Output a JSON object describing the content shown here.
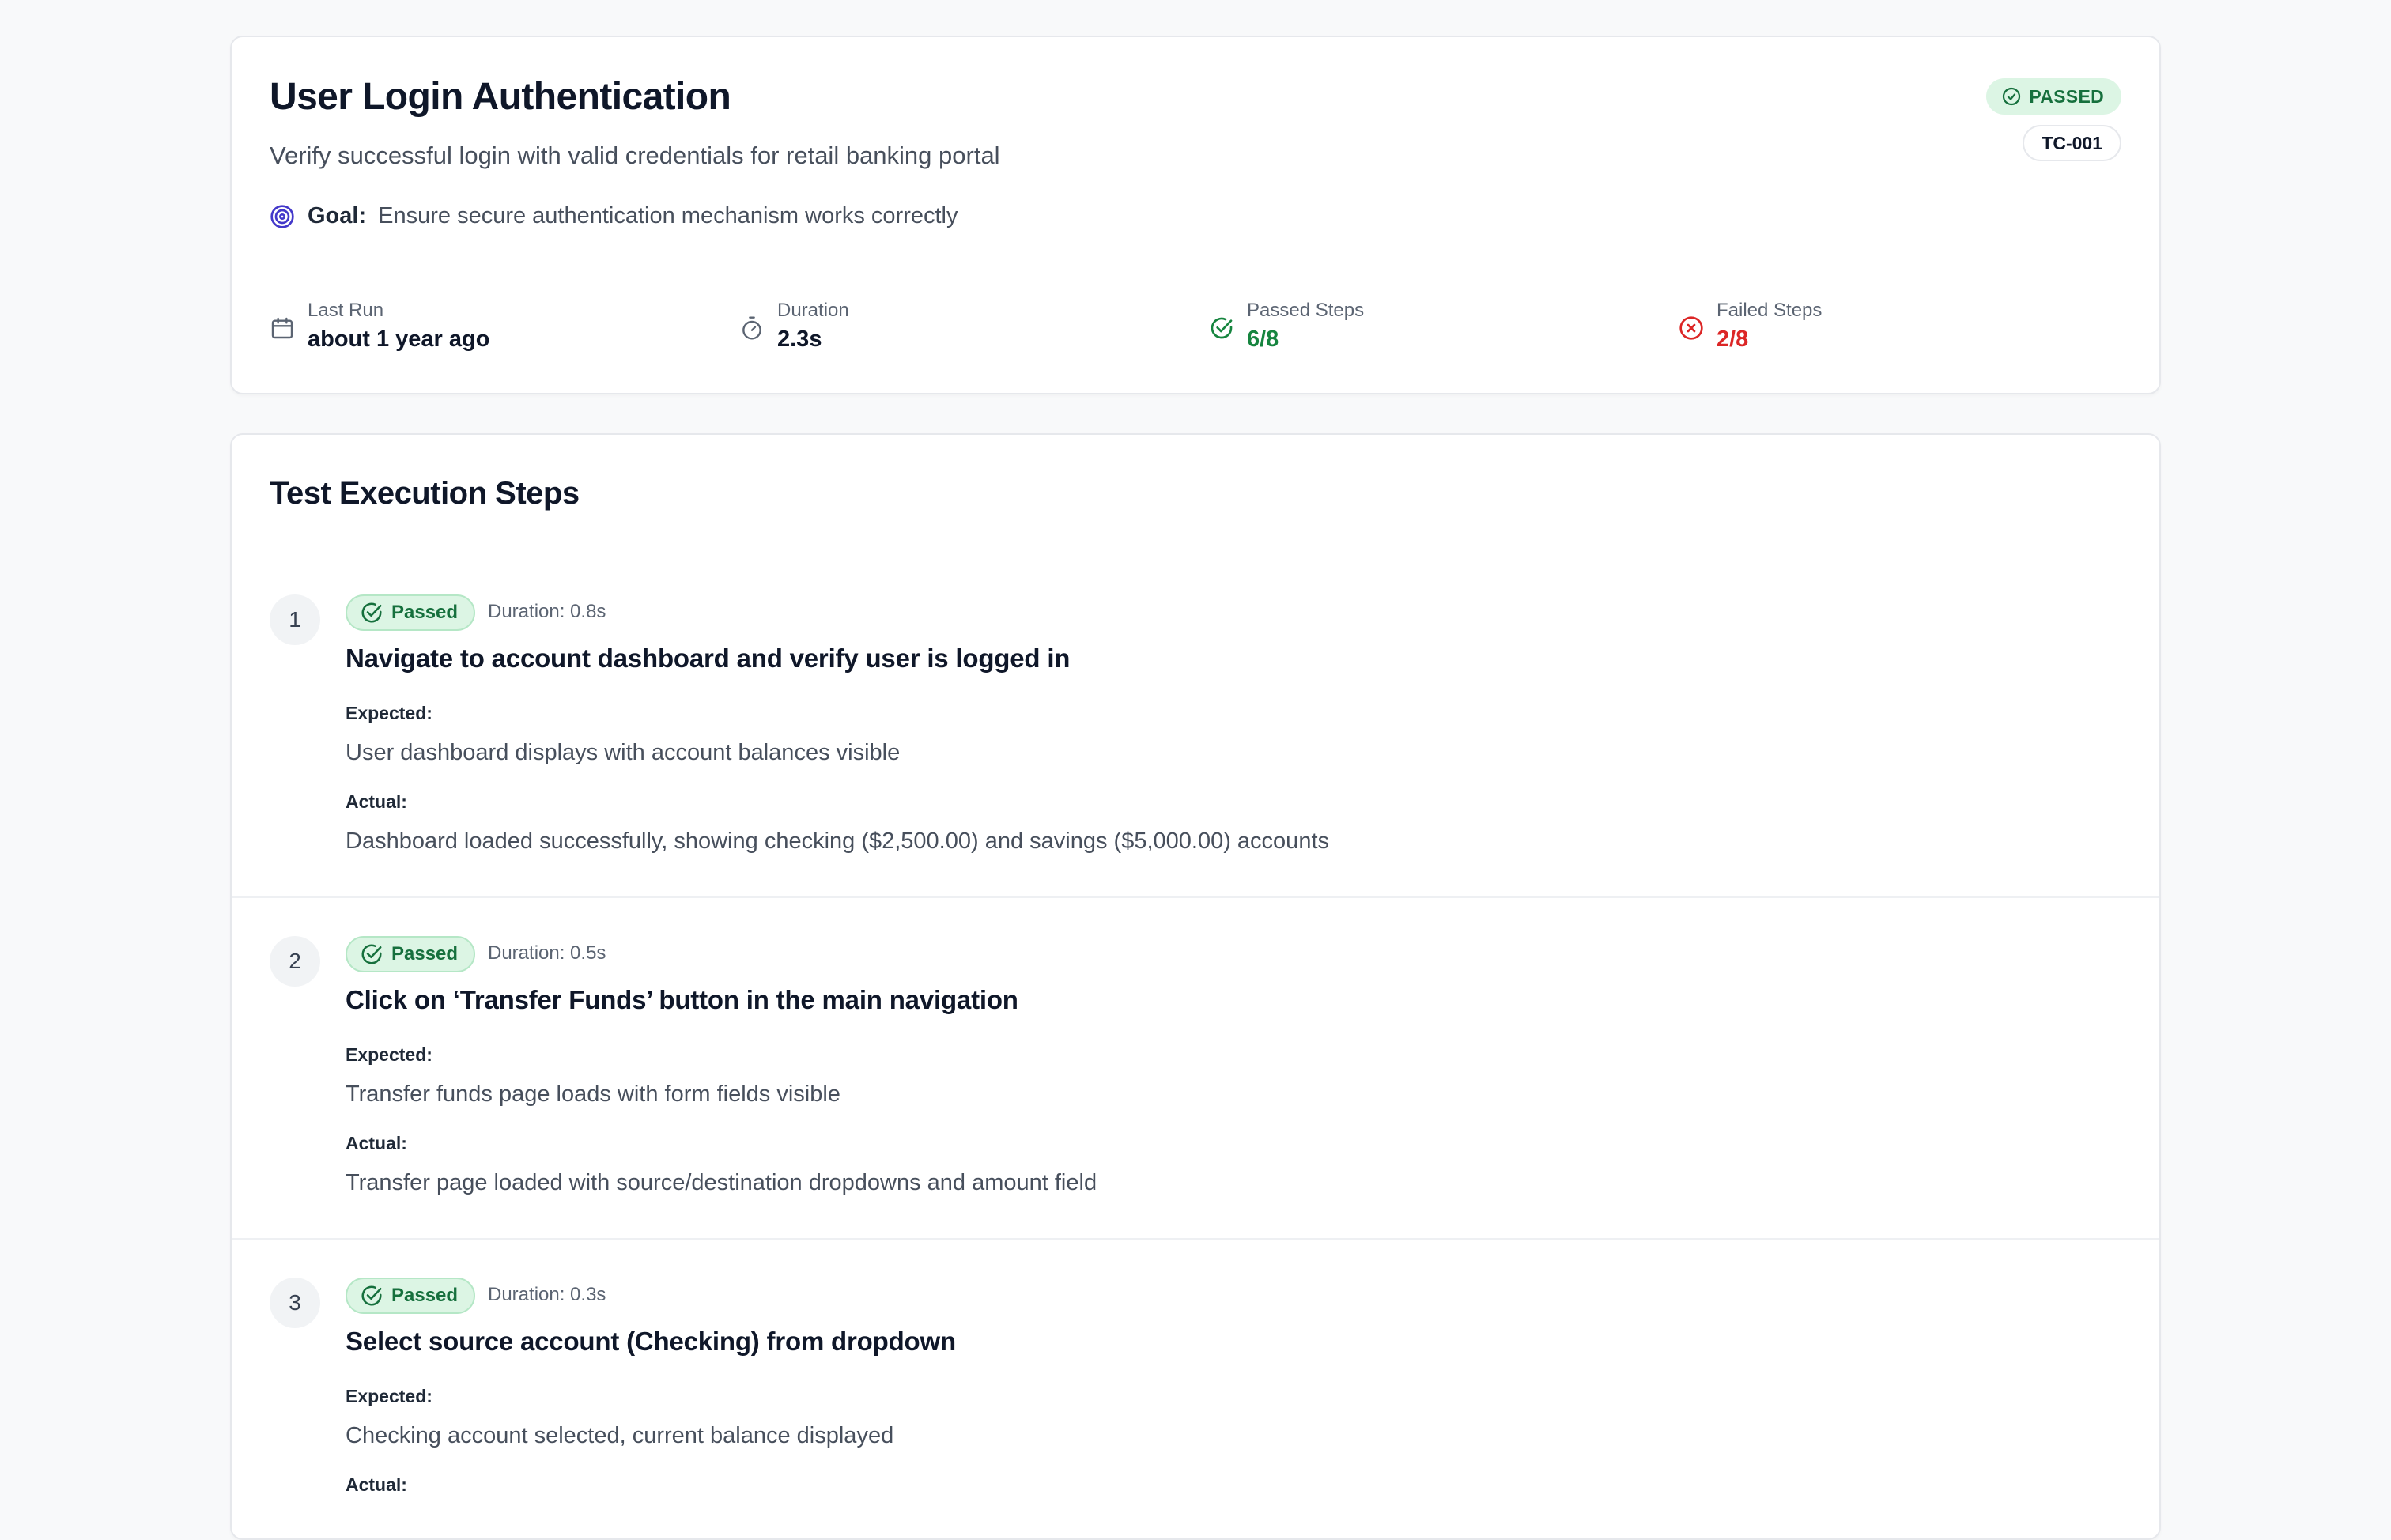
{
  "test_case": {
    "title": "User Login Authentication",
    "description": "Verify successful login with valid credentials for retail banking portal",
    "goal_label": "Goal:",
    "goal_text": "Ensure secure authentication mechanism works correctly",
    "status": "PASSED",
    "id": "TC-001"
  },
  "stats": {
    "last_run": {
      "label": "Last Run",
      "value": "about 1 year ago",
      "icon": "calendar-icon"
    },
    "duration": {
      "label": "Duration",
      "value": "2.3s",
      "icon": "timer-icon"
    },
    "passed": {
      "label": "Passed Steps",
      "value": "6/8",
      "icon": "check-circle-icon"
    },
    "failed": {
      "label": "Failed Steps",
      "value": "2/8",
      "icon": "x-circle-icon"
    }
  },
  "steps_section": {
    "title": "Test Execution Steps",
    "expected_label": "Expected:",
    "actual_label": "Actual:",
    "steps": [
      {
        "number": "1",
        "status": "Passed",
        "duration": "Duration: 0.8s",
        "title": "Navigate to account dashboard and verify user is logged in",
        "expected": "User dashboard displays with account balances visible",
        "actual": "Dashboard loaded successfully, showing checking ($2,500.00) and savings ($5,000.00) accounts"
      },
      {
        "number": "2",
        "status": "Passed",
        "duration": "Duration: 0.5s",
        "title": "Click on ‘Transfer Funds’ button in the main navigation",
        "expected": "Transfer funds page loads with form fields visible",
        "actual": "Transfer page loaded with source/destination dropdowns and amount field"
      },
      {
        "number": "3",
        "status": "Passed",
        "duration": "Duration: 0.3s",
        "title": "Select source account (Checking) from dropdown",
        "expected": "Checking account selected, current balance displayed",
        "actual": ""
      }
    ]
  },
  "colors": {
    "pass_green": "#16853f",
    "fail_red": "#dc2626",
    "goal_accent": "#4338ca",
    "badge_bg": "#dcf5e4"
  }
}
